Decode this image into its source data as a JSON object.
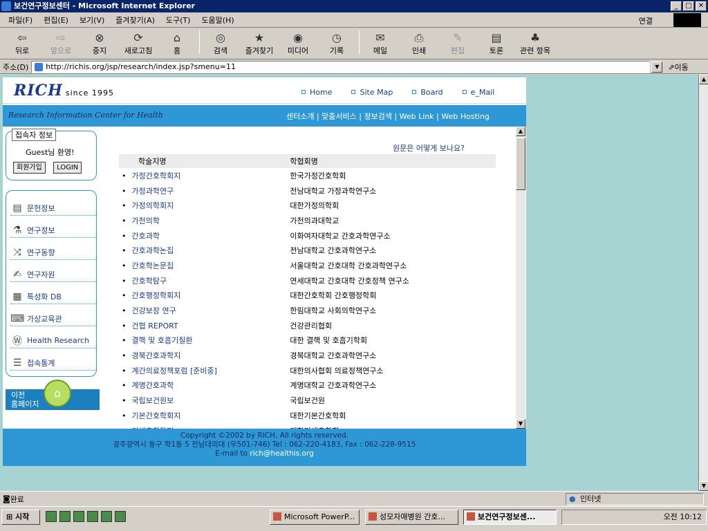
{
  "window": {
    "title": "보건연구정보센터 - Microsoft Internet Explorer"
  },
  "menu": [
    "파일(F)",
    "편집(E)",
    "보기(V)",
    "즐겨찾기(A)",
    "도구(T)",
    "도움말(H)"
  ],
  "menu_right": "연결",
  "toolbar": [
    {
      "label": "뒤로",
      "icon": "back-arrow-icon"
    },
    {
      "label": "앞으로",
      "icon": "forward-arrow-icon"
    },
    {
      "label": "중지",
      "icon": "stop-icon"
    },
    {
      "label": "새로고침",
      "icon": "refresh-icon"
    },
    {
      "label": "홈",
      "icon": "home-icon"
    },
    {
      "label": "검색",
      "icon": "search-icon"
    },
    {
      "label": "즐겨찾기",
      "icon": "favorites-icon"
    },
    {
      "label": "미디어",
      "icon": "media-icon"
    },
    {
      "label": "기록",
      "icon": "history-icon"
    },
    {
      "label": "메일",
      "icon": "mail-icon"
    },
    {
      "label": "인쇄",
      "icon": "print-icon"
    },
    {
      "label": "편집",
      "icon": "edit-icon"
    },
    {
      "label": "토론",
      "icon": "discuss-icon"
    },
    {
      "label": "관련 항목",
      "icon": "related-icon"
    }
  ],
  "address": {
    "label": "주소(D)",
    "url": "http://richis.org/jsp/research/index.jsp?smenu=11",
    "go": "이동"
  },
  "site": {
    "logo": "RICH",
    "since": "since 1995",
    "topnav": [
      "Home",
      "Site Map",
      "Board",
      "e_Mail"
    ],
    "tagline": "Research Information Center for Health",
    "bluenav": "센터소개 | 맞춤서비스 | 정보검색 | Web Link | Web Hosting",
    "guest": {
      "title": "접속자 정보",
      "hello": "Guest님 환영!",
      "join": "회원가입",
      "login": "LOGIN"
    },
    "sidebar": [
      "문헌정보",
      "연구정보",
      "연구동향",
      "연구자원",
      "특성화 DB",
      "가상교육관",
      "Health Research",
      "접속통계"
    ],
    "prevhome": [
      "이전",
      "홈페이지"
    ],
    "question": "원문은 어떻게 보나요?",
    "table_headers": [
      "학술지명",
      "학협회명"
    ],
    "rows": [
      [
        "가정간호학회지",
        "한국가정간호학회"
      ],
      [
        "가정과학연구",
        "전남대학교 가정과학연구소"
      ],
      [
        "가정의학회지",
        "대한가정의학회"
      ],
      [
        "가천의학",
        "가천의과대학교"
      ],
      [
        "간호과학",
        "이화여자대학교 간호과학연구소"
      ],
      [
        "간호과학논집",
        "전남대학교 간호과학연구소"
      ],
      [
        "간호학논문집",
        "서울대학교 간호대학 간호과학연구소"
      ],
      [
        "간호학탐구",
        "연세대학교 간호대학 간호정책 연구소"
      ],
      [
        "간호행정학회지",
        "대한간호학회 간호행정학회"
      ],
      [
        "건강보장 연구",
        "한림대학교 사회의학연구소"
      ],
      [
        "건협 REPORT",
        "건강관리협회"
      ],
      [
        "결핵 및 호흡기질환",
        "대한 결핵 및 호흡기학회"
      ],
      [
        "경북간호과학지",
        "경북대학교 간호과학연구소"
      ],
      [
        "계간의료정책포럼 [준비중]",
        "대한의사협회 의료정책연구소"
      ],
      [
        "계명간호과학",
        "계명대학교 간호과학연구소"
      ],
      [
        "국립보건원보",
        "국립보건원"
      ],
      [
        "기본간호학회지",
        "대한기본간호학회"
      ],
      [
        "기생충학잡지",
        "대한기생충학회"
      ]
    ],
    "footer": {
      "copyright": "Copyright ©2002 by RICH, All rights reserved.",
      "address": "광주광역시 동구 학1동 5 전남대의대 (우501-746) Tel : 062-220-4183, Fax : 062-228-9515",
      "email_prefix": "E-mail to ",
      "email": "rich@healthis.org"
    }
  },
  "status": {
    "text": "완료",
    "zone": "인터넷"
  },
  "taskbar": {
    "start": "시작",
    "tasks": [
      "Microsoft PowerP...",
      "성모자애병원 간호...",
      "보건연구정보센..."
    ],
    "clock": "오전 10:12"
  }
}
